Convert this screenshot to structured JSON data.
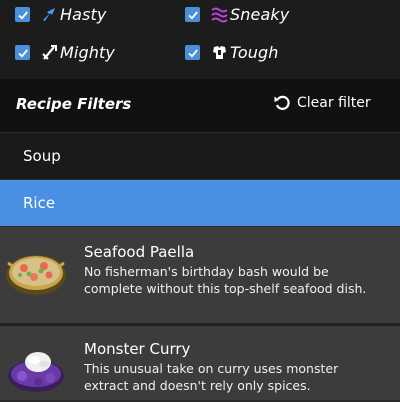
{
  "effects": [
    {
      "label": "Hasty",
      "icon": "hasty-icon",
      "checked": true
    },
    {
      "label": "Sneaky",
      "icon": "sneaky-icon",
      "checked": true
    },
    {
      "label": "Mighty",
      "icon": "mighty-icon",
      "checked": true
    },
    {
      "label": "Tough",
      "icon": "tough-icon",
      "checked": true
    }
  ],
  "filters": {
    "title": "Recipe Filters",
    "clear_label": "Clear filter",
    "items": [
      {
        "label": "Soup",
        "selected": false
      },
      {
        "label": "Rice",
        "selected": true
      }
    ]
  },
  "recipes": [
    {
      "title": "Seafood Paella",
      "description": "No fisherman's birthday bash would be complete without this top-shelf seafood dish.",
      "image": "seafood-paella-image"
    },
    {
      "title": "Monster Curry",
      "description": "This unusual take on curry uses monster extract and doesn't rely only spices.",
      "image": "monster-curry-image"
    }
  ],
  "colors": {
    "accent": "#4a90e2",
    "checkbox": "#4a90d9",
    "hasty_icon": "#3aa0ff",
    "sneaky_icon": "#c040e0"
  }
}
